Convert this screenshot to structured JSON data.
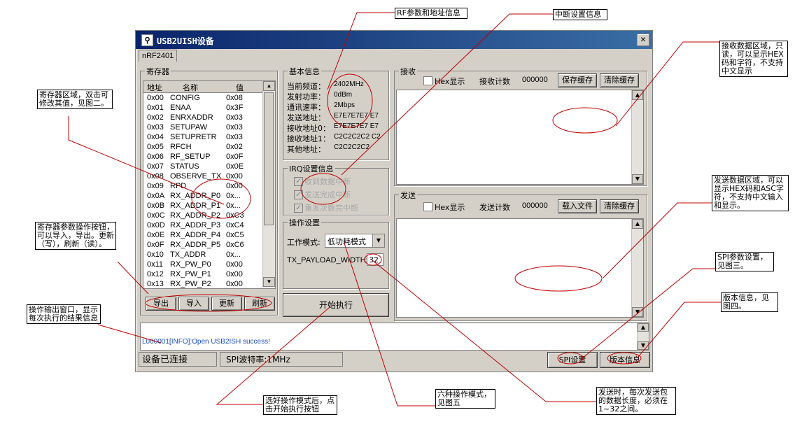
{
  "window": {
    "title": "USB2UISH设备",
    "tab": "nRF2401"
  },
  "registers": {
    "group_title": "寄存器",
    "headers": [
      "地址",
      "名称",
      "值"
    ],
    "rows": [
      [
        "0x00",
        "CONFIG",
        "0x08"
      ],
      [
        "0x01",
        "ENAA",
        "0x3F"
      ],
      [
        "0x02",
        "ENRXADDR",
        "0x03"
      ],
      [
        "0x03",
        "SETUPAW",
        "0x03"
      ],
      [
        "0x04",
        "SETUPRETR",
        "0x03"
      ],
      [
        "0x05",
        "RFCH",
        "0x02"
      ],
      [
        "0x06",
        "RF_SETUP",
        "0x0F"
      ],
      [
        "0x07",
        "STATUS",
        "0x0E"
      ],
      [
        "0x08",
        "OBSERVE_TX",
        "0x00"
      ],
      [
        "0x09",
        "RPD",
        "0x00"
      ],
      [
        "0x0A",
        "RX_ADDR_P0",
        "0x..."
      ],
      [
        "0x0B",
        "RX_ADDR_P1",
        "0x..."
      ],
      [
        "0x0C",
        "RX_ADDR_P2",
        "0xC3"
      ],
      [
        "0x0D",
        "RX_ADDR_P3",
        "0xC4"
      ],
      [
        "0x0E",
        "RX_ADDR_P4",
        "0xC5"
      ],
      [
        "0x0F",
        "RX_ADDR_P5",
        "0xC6"
      ],
      [
        "0x10",
        "TX_ADDR",
        "0x..."
      ],
      [
        "0x11",
        "RX_PW_P0",
        "0x00"
      ],
      [
        "0x12",
        "RX_PW_P1",
        "0x00"
      ],
      [
        "0x13",
        "RX_PW_P2",
        "0x00"
      ]
    ],
    "buttons": {
      "export": "导出",
      "import": "导入",
      "update": "更新",
      "refresh": "刷新"
    }
  },
  "basic_info": {
    "group_title": "基本信息",
    "items": [
      {
        "label": "当前频道：",
        "value": "2402MHz"
      },
      {
        "label": "发射功率：",
        "value": "0dBm"
      },
      {
        "label": "通讯速率：",
        "value": "2Mbps"
      },
      {
        "label": "发送地址：",
        "value": "E7E7E7E7 E7"
      },
      {
        "label": "接收地址0：",
        "value": "E7E7E7E7 E7"
      },
      {
        "label": "接收地址1：",
        "value": "C2C2C2C2 C2"
      },
      {
        "label": "其他地址：",
        "value": "C2C2C2C2"
      }
    ]
  },
  "irq": {
    "group_title": "IRQ设置信息",
    "options": [
      "收到数据中断",
      "发送完成中断",
      "重发次数完中断"
    ]
  },
  "operation": {
    "group_title": "操作设置",
    "mode_label": "工作模式:",
    "mode_value": "低功耗模式",
    "payload_label": "TX_PAYLOAD_WIDTH:",
    "payload_value": "32",
    "start_button": "开始执行"
  },
  "receive": {
    "group_title": "接收",
    "hex_label": "Hex显示",
    "count_label": "接收计数",
    "count_value": "000000",
    "save_button": "保存缓存",
    "clear_button": "清除缓存"
  },
  "send": {
    "group_title": "发送",
    "hex_label": "Hex显示",
    "count_label": "发送计数",
    "count_value": "000000",
    "load_button": "载入文件",
    "clear_button": "清除缓存"
  },
  "output": {
    "log_line": "L000001[INFO]:Open USB2ISH success!",
    "log_color": "#1b4fc4"
  },
  "status_bar": {
    "connection": "设备已连接",
    "spi_rate": "SPI波特率:1MHz",
    "spi_button": "SPI设置",
    "version_button": "版本信息"
  },
  "annotations": {
    "rf_info": "RF参数和地址信息",
    "irq_info": "中断设置信息",
    "receive_area": "接收数据区域，只读，可以显示HEX码和字符，不支持中文显示",
    "register_area": "寄存器区域，双击可修改其值，见图二。",
    "register_ops": "寄存器参数操作按钮，可以导入，导出。更新（写），刷新（读）。",
    "output_window": "操作输出窗口，显示每次执行的结果信息",
    "send_area": "发送数据区域，可以显示HEX码和ASC字符，不支持中文输入和显示。",
    "spi_settings": "SPI参数设置，见图三。",
    "version_info": "版本信息，见图四。",
    "start_hint": "选好操作模式后，点击开始执行按钮",
    "six_modes": "六种操作模式，见图五",
    "payload_hint": "发送时，每次发送包的数据长度，必须在1~32之间。"
  },
  "colors": {
    "title_bar": "#0a246a",
    "annotation_ellipse": "#e00000",
    "face": "#d4d0c8"
  }
}
